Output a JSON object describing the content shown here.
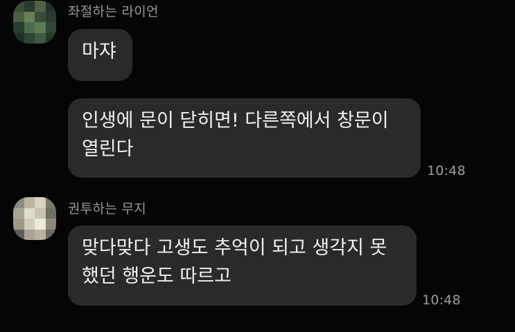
{
  "chat": {
    "messages": [
      {
        "sender": "좌절하는 라이언",
        "text": "마쟈",
        "time": ""
      },
      {
        "sender": "",
        "text": "인생에 문이 닫히면! 다른쪽에서 창문이\n열린다",
        "time": "10:48"
      },
      {
        "sender": "권투하는 무지",
        "text": "맞다맞다 고생도 추억이 되고 생각지 못\n했던 행운도 따르고",
        "time": "10:48"
      }
    ]
  },
  "avatars": [
    {
      "name": "profile-picture-pixelated",
      "colors": [
        "#3d4a3a",
        "#2c3a2e",
        "#506148",
        "#23332a",
        "#4a5e45",
        "#6a7e58",
        "#3a4c3a",
        "#2a3a30",
        "#283c30",
        "#4e6a4e",
        "#5c7a55",
        "#35473a",
        "#1f2e25",
        "#2e4535",
        "#3f5a44",
        "#263a2e"
      ]
    },
    {
      "name": "profile-picture-pixelated",
      "colors": [
        "#8a8a80",
        "#b9b4a4",
        "#d8d2c0",
        "#7a7a70",
        "#a8a498",
        "#e0dccc",
        "#c8c2b0",
        "#6e6e66",
        "#9c9888",
        "#d2ccba",
        "#ece8da",
        "#8c887c",
        "#5e5e58",
        "#a8a292",
        "#b8b2a2",
        "#6a6a62"
      ]
    }
  ]
}
